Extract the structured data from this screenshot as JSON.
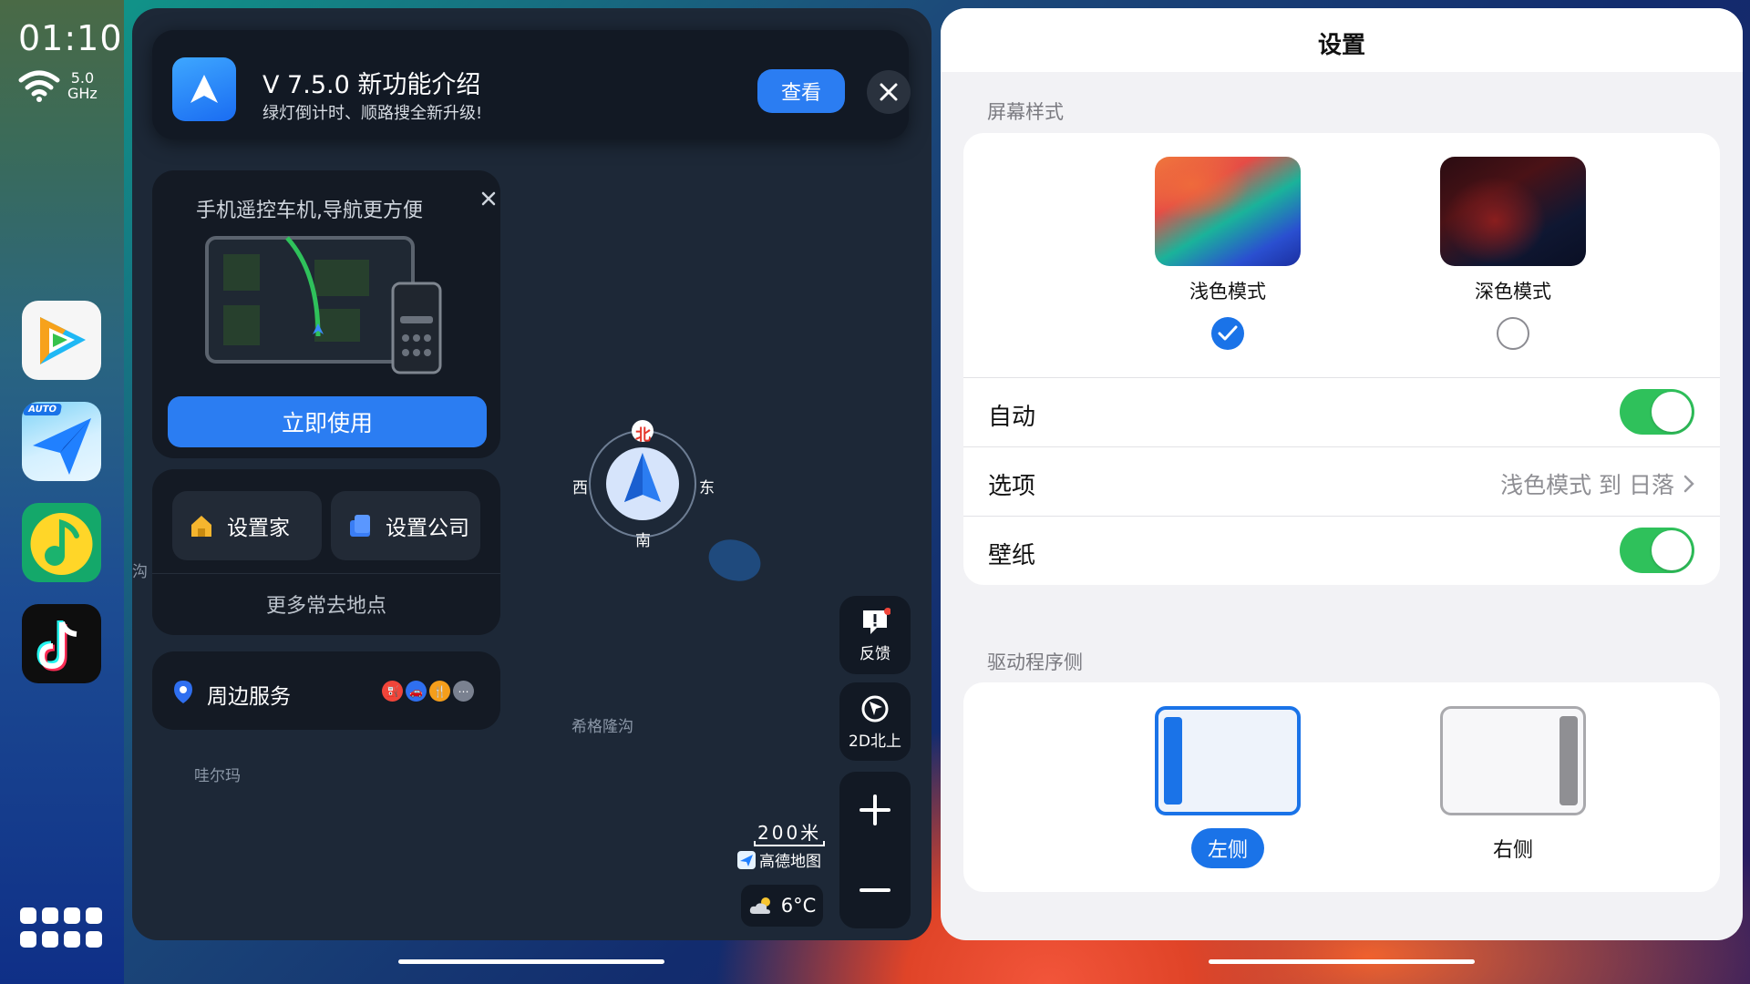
{
  "status": {
    "time": "01:10",
    "wifi_band": "5.0",
    "wifi_unit": "GHz"
  },
  "dock": {
    "apps": [
      {
        "name": "腾讯视频",
        "icon": "video-play-icon"
      },
      {
        "name": "高德地图 AUTO",
        "icon": "amap-auto-icon",
        "badge": "AUTO"
      },
      {
        "name": "QQ音乐",
        "icon": "music-note-icon"
      },
      {
        "name": "抖音",
        "icon": "tiktok-icon"
      }
    ]
  },
  "map": {
    "notice": {
      "title": "V 7.5.0 新功能介绍",
      "subtitle": "绿灯倒计时、顺路搜全新升级!",
      "view_label": "查看"
    },
    "promo": {
      "title": "手机遥控车机,导航更方便",
      "button_label": "立即使用"
    },
    "places": {
      "home_label": "设置家",
      "company_label": "设置公司",
      "more_label": "更多常去地点"
    },
    "nearby": {
      "label": "周边服务"
    },
    "compass": {
      "north": "北",
      "south": "南",
      "east": "东",
      "west": "西"
    },
    "labels": {
      "road1": "希格隆沟",
      "road2": "哇尔玛",
      "road3": "沟"
    },
    "controls": {
      "feedback_label": "反馈",
      "mode_label": "2D北上"
    },
    "scale": "200米",
    "brand": "高德地图",
    "weather": "6°C"
  },
  "settings": {
    "title": "设置",
    "screen_style": {
      "section_label": "屏幕样式",
      "light_label": "浅色模式",
      "dark_label": "深色模式",
      "selected": "light"
    },
    "auto": {
      "label": "自动",
      "on": true
    },
    "options": {
      "label": "选项",
      "value": "浅色模式 到 日落"
    },
    "wallpaper": {
      "label": "壁纸",
      "on": true
    },
    "driver_side": {
      "section_label": "驱动程序侧",
      "left_label": "左侧",
      "right_label": "右侧",
      "selected": "left"
    }
  },
  "colors": {
    "accent": "#1a73e8",
    "toggle_on": "#2fc15b",
    "map_bg": "#1d2837"
  }
}
